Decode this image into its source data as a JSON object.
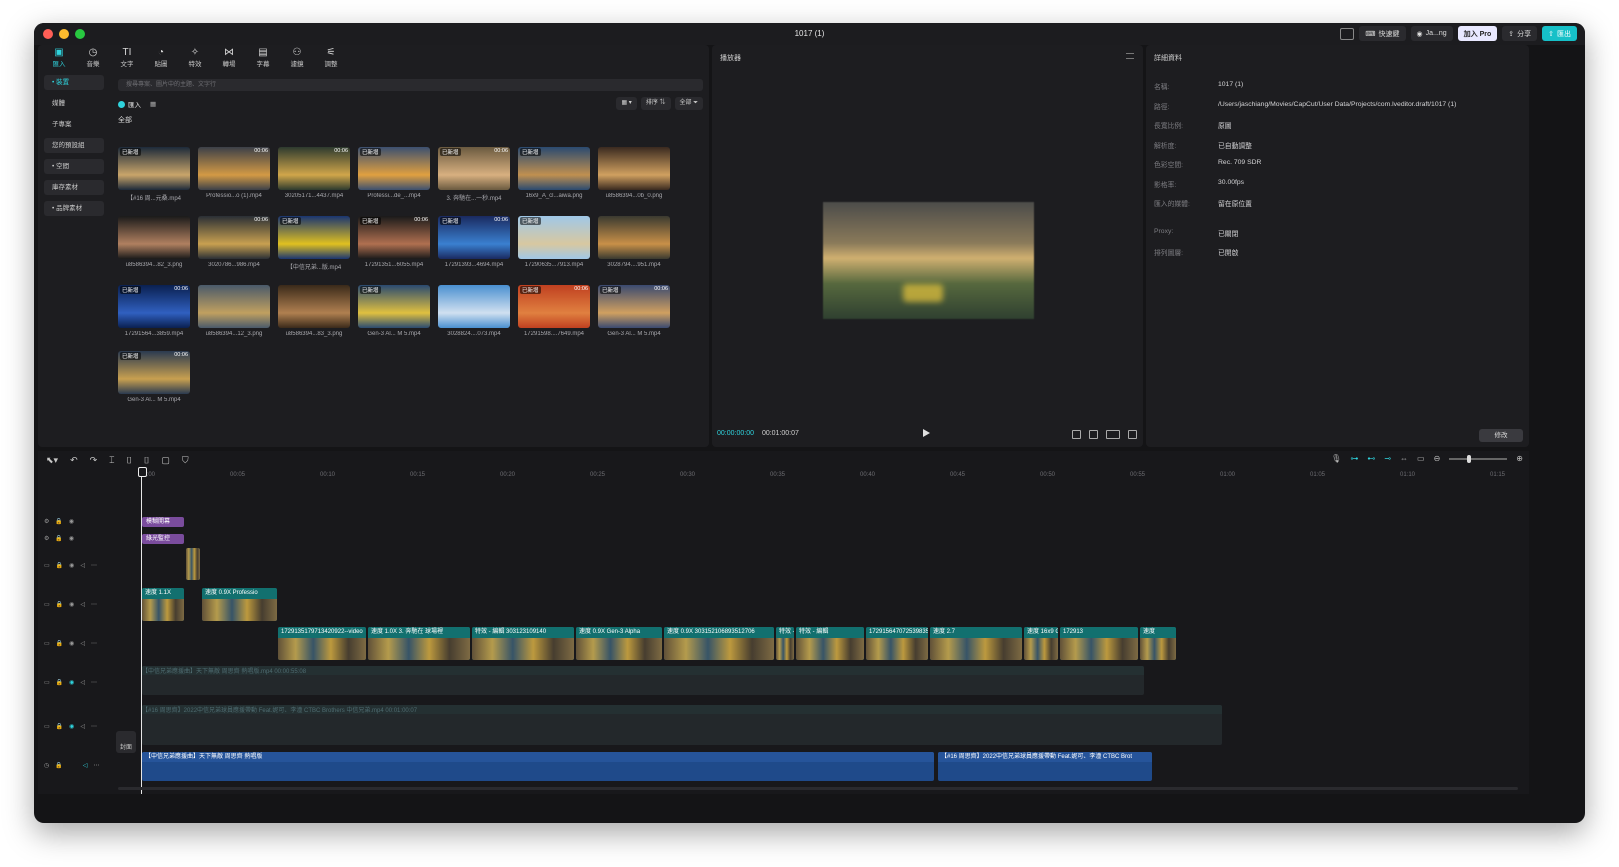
{
  "titlebar": {
    "title": "1017 (1)",
    "shortcuts": "快速鍵",
    "user": "Ja...ng",
    "pro": "加入 Pro",
    "share": "分享",
    "export": "匯出"
  },
  "toolbar": [
    {
      "label": "匯入",
      "icon": "import-icon",
      "glyph": "▣"
    },
    {
      "label": "音樂",
      "icon": "music-icon",
      "glyph": "◷"
    },
    {
      "label": "文字",
      "icon": "text-icon",
      "glyph": "TI"
    },
    {
      "label": "貼圖",
      "icon": "sticker-icon",
      "glyph": "◔"
    },
    {
      "label": "特效",
      "icon": "effects-icon",
      "glyph": "✧"
    },
    {
      "label": "轉場",
      "icon": "transition-icon",
      "glyph": "⋈"
    },
    {
      "label": "字幕",
      "icon": "caption-icon",
      "glyph": "▤"
    },
    {
      "label": "濾鏡",
      "icon": "filter-icon",
      "glyph": "⚇"
    },
    {
      "label": "調整",
      "icon": "adjust-icon",
      "glyph": "⚟"
    }
  ],
  "sidebar": [
    {
      "label": "• 裝置"
    },
    {
      "label": "媒體"
    },
    {
      "label": "子專案"
    },
    {
      "label": "您的預設組"
    },
    {
      "label": "• 空間"
    },
    {
      "label": "庫存素材"
    },
    {
      "label": "• 品牌素材"
    }
  ],
  "media": {
    "search_placeholder": "搜尋專案、圖片中的主題、文字行",
    "import_label": "匯入",
    "sort_label": "排序",
    "filter_label": "全部",
    "all_label": "全部",
    "items": [
      {
        "name": "【#16 周...元桑.mp4",
        "badge": "已新增",
        "dur": "",
        "c1": "#1d2a3a",
        "c2": "#c9a56a"
      },
      {
        "name": "Professio...o (1).mp4",
        "badge": "",
        "dur": "00:06",
        "c1": "#3c4048",
        "c2": "#d39a45"
      },
      {
        "name": "30205171...4437.mp4",
        "badge": "",
        "dur": "00:06",
        "c1": "#2d3a2e",
        "c2": "#d0a64a"
      },
      {
        "name": "Professi...de_...mp4",
        "badge": "已新增",
        "dur": "",
        "c1": "#3c5070",
        "c2": "#e0a040"
      },
      {
        "name": "3. 奔馳在...一秒.mp4",
        "badge": "已新增",
        "dur": "00:06",
        "c1": "#6a5a40",
        "c2": "#d8b080"
      },
      {
        "name": "16x9_A_cl...aiwa.png",
        "badge": "已新增",
        "dur": "",
        "c1": "#2a4a70",
        "c2": "#c09050"
      },
      {
        "name": "u8586394...0b_0.png",
        "badge": "",
        "dur": "",
        "c1": "#3a2a20",
        "c2": "#d0a060"
      },
      {
        "name": "u8586394...82_3.png",
        "badge": "",
        "dur": "",
        "c1": "#1a1a1a",
        "c2": "#b08060"
      },
      {
        "name": "3020786...986.mp4",
        "badge": "",
        "dur": "00:06",
        "c1": "#2a2f35",
        "c2": "#c8a050"
      },
      {
        "name": "【中信兄弟...版.mp4",
        "badge": "已新增",
        "dur": "",
        "c1": "#1a3570",
        "c2": "#e0c020"
      },
      {
        "name": "17291351...6055.mp4",
        "badge": "已新增",
        "dur": "00:06",
        "c1": "#1a1a1a",
        "c2": "#b07050"
      },
      {
        "name": "17291393...4694.mp4",
        "badge": "已新增",
        "dur": "00:06",
        "c1": "#1a2a60",
        "c2": "#3a80d0"
      },
      {
        "name": "17290635...7913.mp4",
        "badge": "已新增",
        "dur": "",
        "c1": "#a0c8e8",
        "c2": "#d8c8a0"
      },
      {
        "name": "3028794....951.mp4",
        "badge": "",
        "dur": "",
        "c1": "#3a3a30",
        "c2": "#c89048"
      },
      {
        "name": "17291564...3859.mp4",
        "badge": "已新增",
        "dur": "00:06",
        "c1": "#0a2050",
        "c2": "#3060c0"
      },
      {
        "name": "u8586394...12_3.png",
        "badge": "",
        "dur": "",
        "c1": "#4a5a6a",
        "c2": "#c0a060"
      },
      {
        "name": "u8586394...83_3.png",
        "badge": "",
        "dur": "",
        "c1": "#3a2a1a",
        "c2": "#b08050"
      },
      {
        "name": "Gen-3 Al... M 5.mp4",
        "badge": "已新增",
        "dur": "",
        "c1": "#2a4a70",
        "c2": "#e0c040"
      },
      {
        "name": "3028824....073.mp4",
        "badge": "",
        "dur": "",
        "c1": "#4a90d0",
        "c2": "#d0e0f0"
      },
      {
        "name": "17291598....7649.mp4",
        "badge": "已新增",
        "dur": "00:06",
        "c1": "#c04020",
        "c2": "#e08040"
      },
      {
        "name": "Gen-3 Al... M 5.mp4",
        "badge": "已新增",
        "dur": "00:06",
        "c1": "#3a4a70",
        "c2": "#d0a060"
      },
      {
        "name": "Gen-3 Al... M 5.mp4",
        "badge": "已新增",
        "dur": "00:06",
        "c1": "#2a3a50",
        "c2": "#c8a050"
      }
    ]
  },
  "player": {
    "title": "播放器",
    "current_time": "00:00:00:00",
    "total_time": "00:01:00:07"
  },
  "details": {
    "title": "詳細資料",
    "rows": [
      {
        "k": "名稱:",
        "v": "1017 (1)"
      },
      {
        "k": "路徑:",
        "v": "/Users/jaschiang/Movies/CapCut/User Data/Projects/com.lveditor.draft/1017 (1)"
      },
      {
        "k": "長寬比例:",
        "v": "原圖"
      },
      {
        "k": "解析度:",
        "v": "已自動調整"
      },
      {
        "k": "色彩空間:",
        "v": "Rec. 709 SDR"
      },
      {
        "k": "影格率:",
        "v": "30.00fps"
      },
      {
        "k": "匯入的媒體:",
        "v": "留在原位置"
      },
      {
        "k": "Proxy:",
        "v": "已關閉"
      },
      {
        "k": "排列圖層:",
        "v": "已開啟"
      }
    ],
    "edit_label": "修改"
  },
  "timeline": {
    "ruler": [
      "00:00",
      "00:05",
      "00:10",
      "00:15",
      "00:20",
      "00:25",
      "00:30",
      "00:35",
      "00:40",
      "00:45",
      "00:50",
      "00:55",
      "01:00",
      "01:05",
      "01:10",
      "01:15"
    ],
    "fx1": "模糊開幕",
    "fx2": "綠光監控",
    "clip_a": "速度 1.1X",
    "clip_b": "速度 0.9X  Professio",
    "main_clips": [
      "17291351797134209​22--video",
      "速度 1.0X  3. 奔馳在 球場裡",
      "特效 - 編輯  303123109140",
      "速度 0.9X  Gen-3 Alpha",
      "速度 0.9X  303152106893512706",
      "特效 - 編輯  Gen-3",
      "特效 - 編輯",
      "1729156470725398356--vid",
      "速度 2.7",
      "速度  16x9  Gen-3 Al",
      "172913",
      "速度"
    ],
    "dim1": "【中信兄弟應援曲】天下無敵 周思齊 熱唱版.mp4  00:00:55:08",
    "dim2": "【#16 周思齊】2022中信兄弟球員應援帶動 Feat.妮可、李潼 CTBC Brothers 中信兄弟.mp4  00:01:00:07",
    "audio1": "【中信兄弟應援曲】天下無敵 周思齊 熱唱版",
    "audio2": "【#16 周思齊】2022中信兄弟球員應援帶動 Feat.妮可、李潼 CTBC Brot",
    "cover_label": "封面"
  }
}
